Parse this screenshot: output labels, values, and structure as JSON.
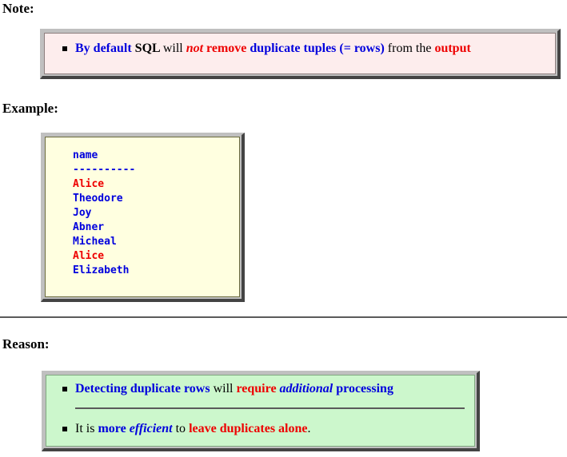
{
  "headings": {
    "note": "Note:",
    "example": "Example:",
    "reason": "Reason:"
  },
  "note_box": {
    "background_color": "#fdeded",
    "bullets": [
      {
        "runs": [
          {
            "text": "By default ",
            "style": "blue-bold"
          },
          {
            "text": "SQL ",
            "style": "black-bold"
          },
          {
            "text": "will ",
            "style": "black-normal"
          },
          {
            "text": "not ",
            "style": "red-bold-italic"
          },
          {
            "text": "remove ",
            "style": "red-bold"
          },
          {
            "text": "duplicate tuples (= rows) ",
            "style": "blue-bold"
          },
          {
            "text": "from the ",
            "style": "black-normal"
          },
          {
            "text": "output",
            "style": "red-bold"
          }
        ]
      }
    ]
  },
  "example_box": {
    "background_color": "#ffffe0",
    "column_header": "name",
    "separator": "----------",
    "rows": [
      {
        "value": "Alice",
        "color": "red"
      },
      {
        "value": "Theodore",
        "color": "blue"
      },
      {
        "value": "Joy",
        "color": "blue"
      },
      {
        "value": "Abner",
        "color": "blue"
      },
      {
        "value": "Micheal",
        "color": "blue"
      },
      {
        "value": "Alice",
        "color": "red"
      },
      {
        "value": "Elizabeth",
        "color": "blue"
      }
    ]
  },
  "reason_box": {
    "background_color": "#ccf7cc",
    "bullets": [
      {
        "runs": [
          {
            "text": "Detecting duplicate rows ",
            "style": "blue-bold"
          },
          {
            "text": "will ",
            "style": "black-normal"
          },
          {
            "text": "require ",
            "style": "red-bold"
          },
          {
            "text": "additional ",
            "style": "blue-bold-italic"
          },
          {
            "text": "processing",
            "style": "blue-bold"
          }
        ]
      },
      {
        "runs": [
          {
            "text": "It is ",
            "style": "black-normal"
          },
          {
            "text": "more ",
            "style": "blue-bold"
          },
          {
            "text": "efficient ",
            "style": "blue-bold-italic"
          },
          {
            "text": "to ",
            "style": "black-normal"
          },
          {
            "text": "leave duplicates alone",
            "style": "red-bold"
          },
          {
            "text": ".",
            "style": "black-normal"
          }
        ]
      }
    ]
  },
  "colors": {
    "blue": "#0000dd",
    "red": "#ee0000",
    "black": "#000000",
    "bevel_light": "#c0c0c0",
    "bevel_dark": "#444444",
    "rule": "#5a5a5a"
  }
}
